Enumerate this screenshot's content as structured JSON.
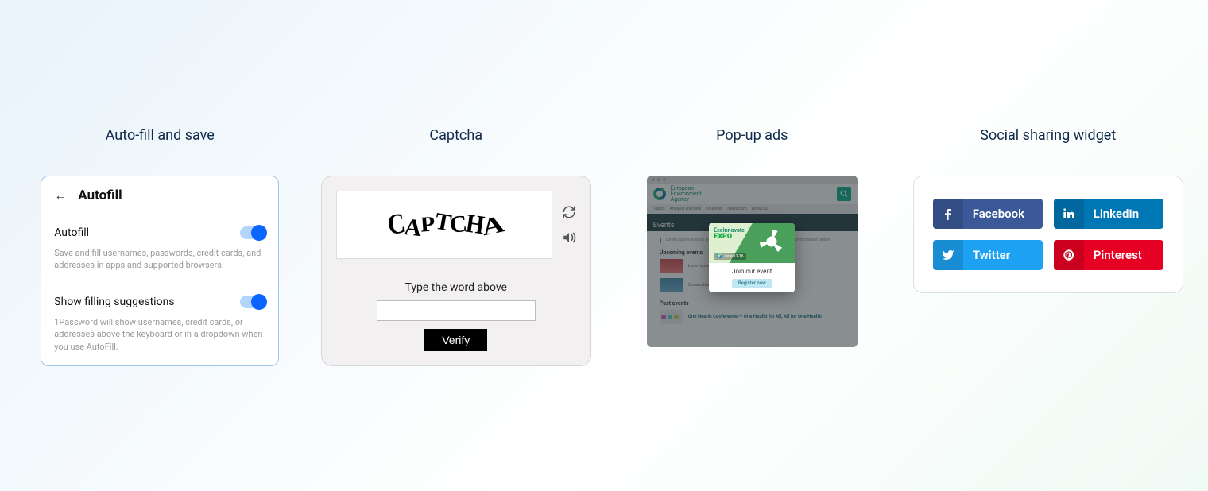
{
  "columns": {
    "autofill": {
      "title": "Auto-fill and save"
    },
    "captcha": {
      "title": "Captcha"
    },
    "popup": {
      "title": "Pop-up ads"
    },
    "social": {
      "title": "Social sharing widget"
    }
  },
  "autofill": {
    "header": "Autofill",
    "opt1_label": "Autofill",
    "opt1_desc": "Save and fill usernames, passwords, credit cards, and addresses in apps and supported browsers.",
    "opt2_label": "Show filling suggestions",
    "opt2_desc": "1Password will show usernames, credit cards, or addresses above the keyboard or in a dropdown when you use AutoFill."
  },
  "captcha": {
    "image_text": "CAPTCHA",
    "instruction": "Type the word above",
    "verify": "Verify"
  },
  "popup": {
    "brand_top": "European",
    "brand_mid": "Environment",
    "brand_bot": "Agency",
    "banner": "Events",
    "intro": "Lorem ipsum dolor sit amet consectetur adipiscing elit sed eiusmod tempor incididunt labore.",
    "upcoming": "Upcoming events",
    "past": "Past events",
    "past_event_title": "One Health Conference — One Health for All, All for One Health",
    "modal_brand1": "EcoInnovate",
    "modal_brand2": "EXPO",
    "modal_date": "June 12-16",
    "modal_title": "Join our event",
    "modal_cta": "Register now",
    "nav": [
      "Topics",
      "Analysis and data",
      "Countries",
      "Newsroom",
      "About us"
    ]
  },
  "social": {
    "facebook": "Facebook",
    "linkedin": "LinkedIn",
    "twitter": "Twitter",
    "pinterest": "Pinterest"
  }
}
